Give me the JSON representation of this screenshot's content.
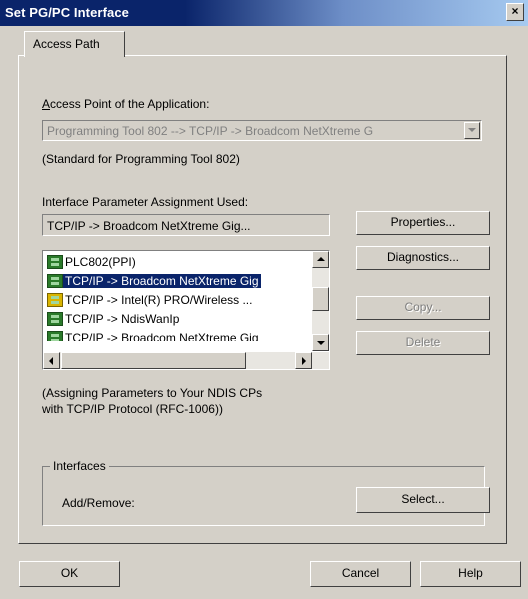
{
  "window": {
    "title": "Set PG/PC Interface",
    "close": "×"
  },
  "tab": {
    "label": "Access Path"
  },
  "access_point": {
    "label": "Access Point of the Application:",
    "value": "Programming Tool 802     --> TCP/IP -> Broadcom NetXtreme G",
    "note": "(Standard for Programming Tool 802)"
  },
  "interface_param": {
    "label": "Interface Parameter Assignment Used:",
    "value": "TCP/IP -> Broadcom NetXtreme Gig..."
  },
  "list_items": [
    {
      "label": "PLC802(PPI)"
    },
    {
      "label": "TCP/IP -> Broadcom NetXtreme Gig"
    },
    {
      "label": "TCP/IP -> Intel(R) PRO/Wireless ..."
    },
    {
      "label": "TCP/IP -> NdisWanIp"
    },
    {
      "label": "TCP/IP -> Broadcom NetXtreme Gig"
    }
  ],
  "buttons": {
    "properties": "Properties...",
    "diagnostics": "Diagnostics...",
    "copy": "Copy...",
    "delete": "Delete",
    "select": "Select...",
    "ok": "OK",
    "cancel": "Cancel",
    "help": "Help"
  },
  "description": {
    "line1": "(Assigning Parameters to Your NDIS CPs",
    "line2": "with TCP/IP Protocol (RFC-1006))"
  },
  "interfaces": {
    "group_label": "Interfaces",
    "add_remove": "Add/Remove:"
  }
}
